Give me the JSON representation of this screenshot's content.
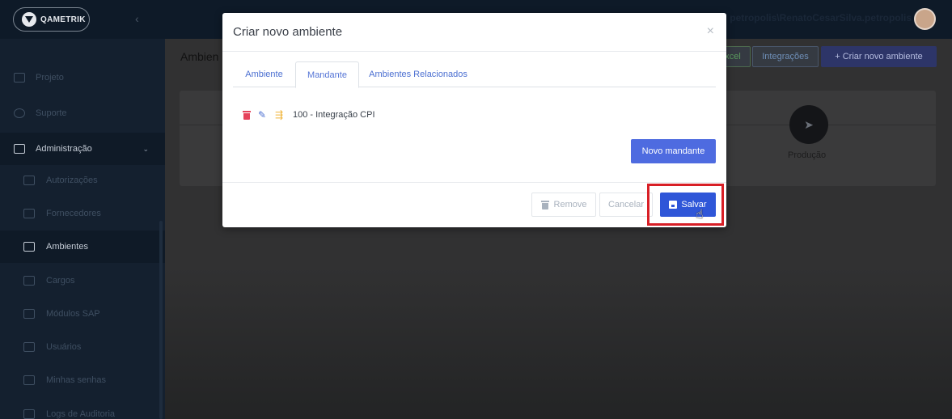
{
  "app": {
    "logo_text": "QAMETRIK"
  },
  "header": {
    "user_label": "petropolis\\RenatoCesarSilva.petropolis"
  },
  "sidebar": {
    "items": [
      {
        "label": "Projeto"
      },
      {
        "label": "Suporte"
      },
      {
        "label": "Administração"
      },
      {
        "label": "Autorizações"
      },
      {
        "label": "Fornecedores"
      },
      {
        "label": "Ambientes"
      },
      {
        "label": "Cargos"
      },
      {
        "label": "Módulos SAP"
      },
      {
        "label": "Usuários"
      },
      {
        "label": "Minhas senhas"
      },
      {
        "label": "Logs de Auditoria"
      }
    ],
    "active": "Ambientes"
  },
  "main": {
    "title": "Ambien",
    "buttons": {
      "excel": "xcel",
      "integracoes": "Integrações",
      "create": "+ Criar novo ambiente"
    },
    "stage_label": "Produção"
  },
  "modal": {
    "title": "Criar novo ambiente",
    "close": "×",
    "tabs": [
      {
        "label": "Ambiente"
      },
      {
        "label": "Mandante"
      },
      {
        "label": "Ambientes Relacionados"
      }
    ],
    "active_tab": "Mandante",
    "entry": {
      "label": "100 - Integração CPI"
    },
    "novo_mandante_label": "Novo mandante",
    "remove_label": "Remove",
    "cancel_label": "Cancelar",
    "save_label": "Salvar"
  },
  "colors": {
    "primary": "#2f56d8",
    "highlight": "#d81f26",
    "danger": "#e5435b"
  }
}
